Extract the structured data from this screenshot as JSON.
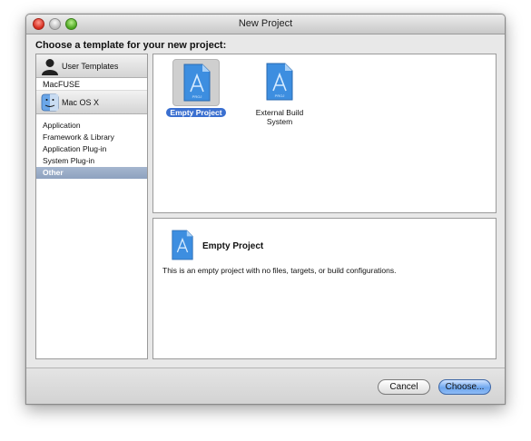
{
  "window": {
    "title": "New Project"
  },
  "heading": "Choose a template for your new project:",
  "sidebar": {
    "user_templates": {
      "label": "User Templates",
      "icon": "user-silhouette-icon"
    },
    "macfuse": "MacFUSE",
    "macosx": {
      "label": "Mac OS X",
      "icon": "finder-icon"
    },
    "items": [
      {
        "label": "Application"
      },
      {
        "label": "Framework & Library"
      },
      {
        "label": "Application Plug-in"
      },
      {
        "label": "System Plug-in"
      },
      {
        "label": "Other"
      }
    ],
    "selected_item": "Other"
  },
  "templates": [
    {
      "label": "Empty Project",
      "icon": "project-document-icon",
      "selected": true
    },
    {
      "label": "External Build System",
      "icon": "project-document-icon",
      "selected": false
    }
  ],
  "description": {
    "name": "Empty Project",
    "text": "This is an empty project with no files, targets, or build configurations.",
    "icon": "project-document-icon"
  },
  "buttons": {
    "cancel": "Cancel",
    "choose": "Choose..."
  },
  "colors": {
    "selection": "#3a6fd0",
    "sidebar_selected": "#8ea2bf",
    "doc_blue": "#3d8ee0"
  }
}
